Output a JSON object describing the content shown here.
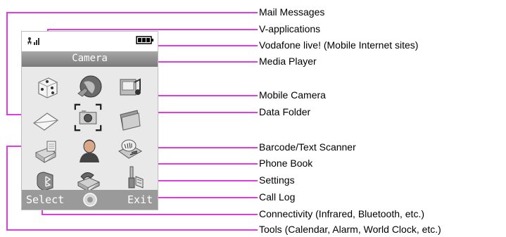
{
  "phone": {
    "title": "Camera",
    "softkey_left": "Select",
    "softkey_right": "Exit",
    "signal_label": "signal-icon",
    "battery_label": "battery-icon"
  },
  "callouts": [
    {
      "label": "Mail Messages",
      "icon": "envelope-icon"
    },
    {
      "label": "V-applications",
      "icon": "dice-icon"
    },
    {
      "label": "Vodafone live! (Mobile Internet sites)",
      "icon": "globe-icon"
    },
    {
      "label": "Media Player",
      "icon": "media-player-icon"
    },
    {
      "label": "Mobile Camera",
      "icon": "camera-icon"
    },
    {
      "label": "Data Folder",
      "icon": "folder-icon"
    },
    {
      "label": "Barcode/Text Scanner",
      "icon": "scanner-icon"
    },
    {
      "label": "Phone Book",
      "icon": "person-icon"
    },
    {
      "label": "Settings",
      "icon": "settings-icon"
    },
    {
      "label": "Call Log",
      "icon": "phone-icon"
    },
    {
      "label": "Connectivity (Infrared, Bluetooth, etc.)",
      "icon": "connectivity-icon"
    },
    {
      "label": "Tools (Calendar, Alarm, World Clock, etc.)",
      "icon": "tools-icon"
    }
  ],
  "colors": {
    "leader": "#e23be2",
    "screen_bg": "#e9e9e9",
    "title_bar": "#8c8c8c",
    "softkey_bar": "#9a9a9a"
  }
}
